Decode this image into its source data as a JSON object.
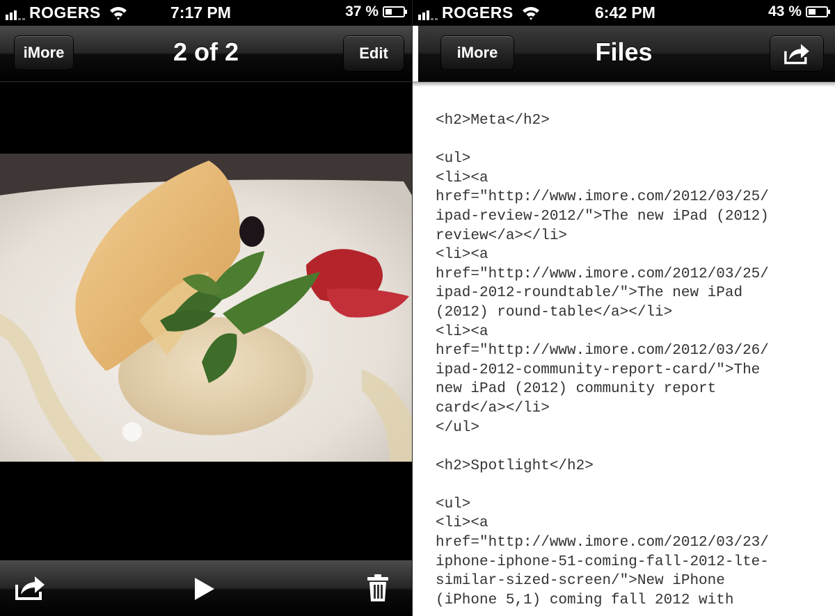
{
  "left_screen": {
    "status": {
      "carrier": "ROGERS",
      "time": "7:17 PM",
      "battery": "37 %",
      "battery_level": 0.37
    },
    "nav": {
      "back_label": "iMore",
      "title": "2 of 2",
      "edit_label": "Edit"
    },
    "toolbar": {
      "icons": [
        "share-icon",
        "play-icon",
        "trash-icon"
      ]
    }
  },
  "right_screen": {
    "status": {
      "carrier": "ROGERS",
      "time": "6:42 PM",
      "battery": "43 %",
      "battery_level": 0.43
    },
    "nav": {
      "back_label": "iMore",
      "title": "Files",
      "action_icon": "share-icon"
    },
    "code_lines": [
      "<h2>Meta</h2>",
      "",
      "<ul>",
      "<li><a",
      "href=\"http://www.imore.com/2012/03/25/",
      "ipad-review-2012/\">The new iPad (2012)",
      "review</a></li>",
      "<li><a",
      "href=\"http://www.imore.com/2012/03/25/",
      "ipad-2012-roundtable/\">The new iPad",
      "(2012) round-table</a></li>",
      "<li><a",
      "href=\"http://www.imore.com/2012/03/26/",
      "ipad-2012-community-report-card/\">The",
      "new iPad (2012) community report",
      "card</a></li>",
      "</ul>",
      "",
      "<h2>Spotlight</h2>",
      "",
      "<ul>",
      "<li><a",
      "href=\"http://www.imore.com/2012/03/23/",
      "iphone-iphone-51-coming-fall-2012-lte-",
      "similar-sized-screen/\">New iPhone",
      "(iPhone 5,1) coming fall 2012 with"
    ]
  },
  "colors": {
    "bar_dark": "#000000",
    "code_text": "#333333"
  }
}
